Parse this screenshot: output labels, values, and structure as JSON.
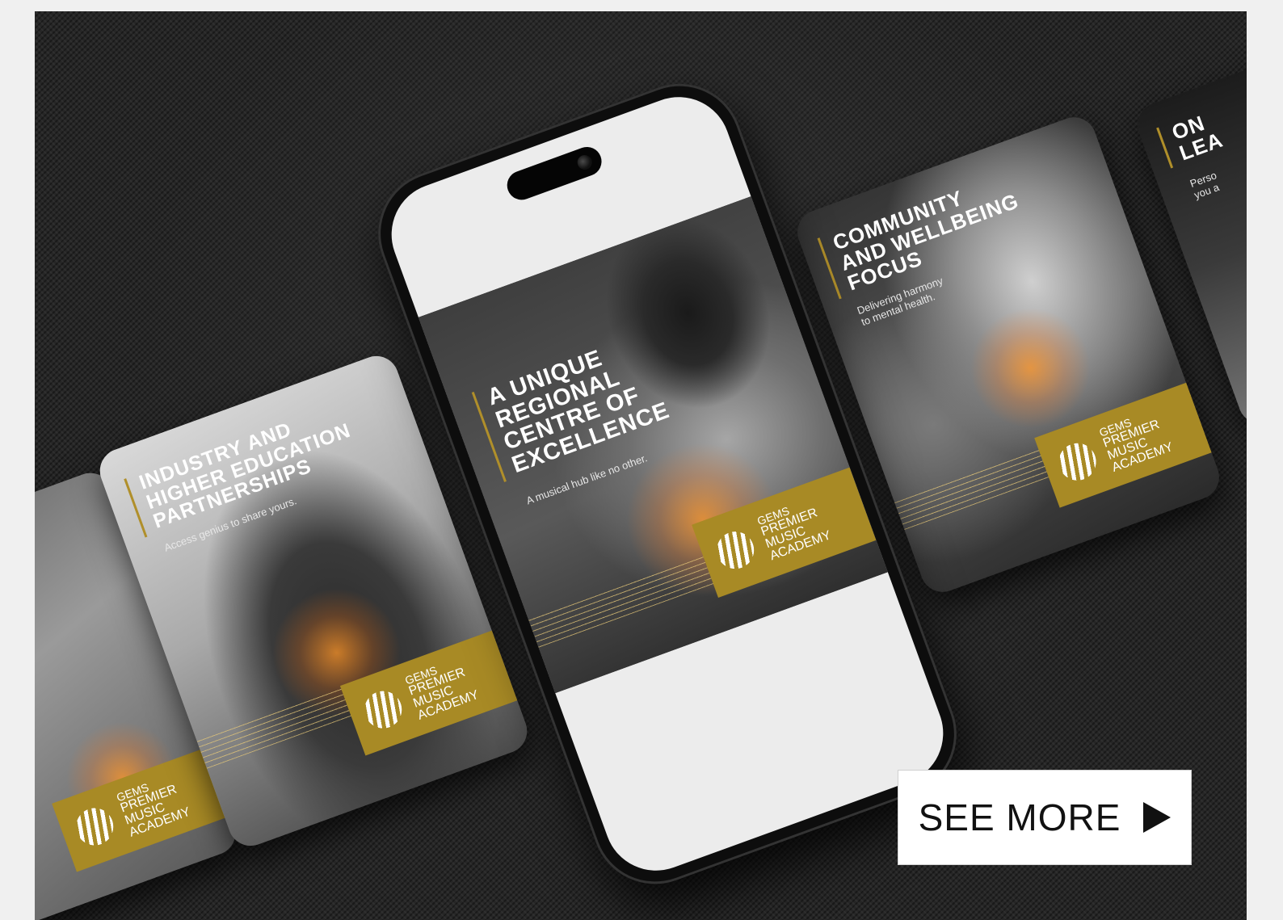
{
  "cards": {
    "left_partial": {
      "logo_small": "GEMS",
      "logo_big": "PREMIER\nMUSIC\nACADEMY"
    },
    "industry": {
      "headline": "INDUSTRY AND\nHIGHER EDUCATION\nPARTNERSHIPS",
      "tagline": "Access genius to share yours.",
      "logo_small": "GEMS",
      "logo_big": "PREMIER\nMUSIC\nACADEMY"
    },
    "community": {
      "headline": "COMMUNITY\nAND WELLBEING\nFOCUS",
      "tagline": "Delivering harmony\nto mental health.",
      "logo_small": "GEMS",
      "logo_big": "PREMIER\nMUSIC\nACADEMY"
    },
    "right_partial": {
      "headline": "ON\nLEA",
      "tagline": "Perso\nyou a"
    }
  },
  "phone": {
    "headline": "A UNIQUE\nREGIONAL\nCENTRE OF\nEXCELLENCE",
    "tagline": "A musical hub like no other.",
    "logo_small": "GEMS",
    "logo_big": "PREMIER\nMUSIC\nACADEMY"
  },
  "cta": {
    "label": "SEE MORE",
    "icon": "play-arrow-icon"
  },
  "colors": {
    "gold": "#a88a25",
    "background": "#262626",
    "page": "#f0f0f0"
  }
}
